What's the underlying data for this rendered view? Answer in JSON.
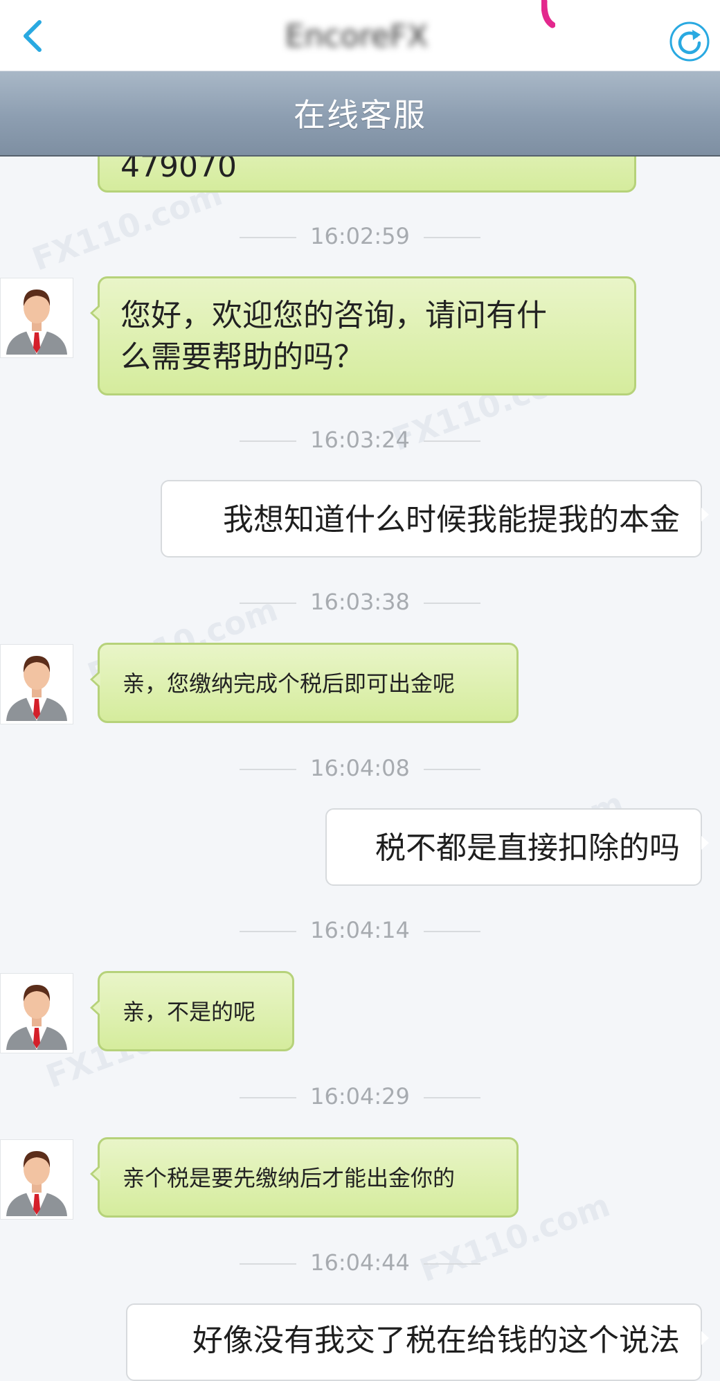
{
  "nav": {
    "app_title": "EncoreFX",
    "back_icon": "chevron-left-icon",
    "refresh_icon": "refresh-icon"
  },
  "header": {
    "title": "在线客服"
  },
  "colors": {
    "accent": "#29a9e1",
    "agent_bubble": "#d9eea5",
    "user_bubble": "#ffffff",
    "header_band": "#8d9eb1"
  },
  "messages": [
    {
      "sender": "agent",
      "text": "479070"
    },
    {
      "sender": "agent",
      "time": "16:02:59",
      "text": "您好，欢迎您的咨询，请问有什么需要帮助的吗？",
      "line1": "您好，欢迎您的咨询，请问有什",
      "line2": "么需要帮助的吗？"
    },
    {
      "sender": "user",
      "time": "16:03:24",
      "text": "我想知道什么时候我能提我的本金"
    },
    {
      "sender": "agent",
      "time": "16:03:38",
      "text": "亲，您缴纳完成个税后即可出金呢"
    },
    {
      "sender": "user",
      "time": "16:04:08",
      "text": "税不都是直接扣除的吗"
    },
    {
      "sender": "agent",
      "time": "16:04:14",
      "text": "亲，不是的呢"
    },
    {
      "sender": "agent",
      "time": "16:04:29",
      "text": "亲个税是要先缴纳后才能出金你的"
    },
    {
      "sender": "user",
      "time": "16:04:44",
      "text": "好像没有我交了税在给钱的这个说法"
    }
  ]
}
